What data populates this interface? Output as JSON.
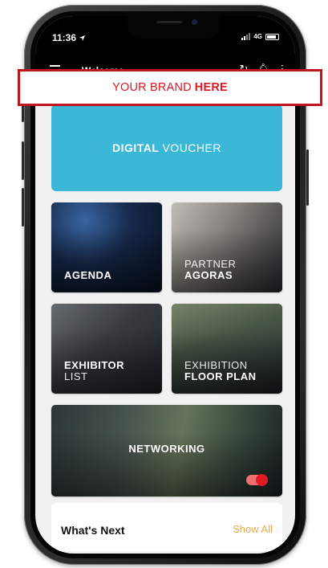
{
  "status": {
    "time": "11:36",
    "network": "4G"
  },
  "app_bar": {
    "title": "Welcome"
  },
  "brand_banner": {
    "light": "YOUR BRAND",
    "bold": "HERE"
  },
  "voucher": {
    "bold": "DIGITAL",
    "light": "VOUCHER",
    "color": "#3bb7d8"
  },
  "tiles": [
    {
      "light": "",
      "bold": "AGENDA"
    },
    {
      "light": "PARTNER",
      "bold": "AGORAS"
    },
    {
      "light": "LIST",
      "bold": "EXHIBITOR"
    },
    {
      "light": "EXHIBITION",
      "bold": "FLOOR PLAN"
    },
    {
      "light": "",
      "bold": "NETWORKING"
    }
  ],
  "whats_next": {
    "title": "What's Next",
    "link": "Show All"
  },
  "colors": {
    "accent_red": "#d81921",
    "link_orange": "#e8a94a"
  }
}
